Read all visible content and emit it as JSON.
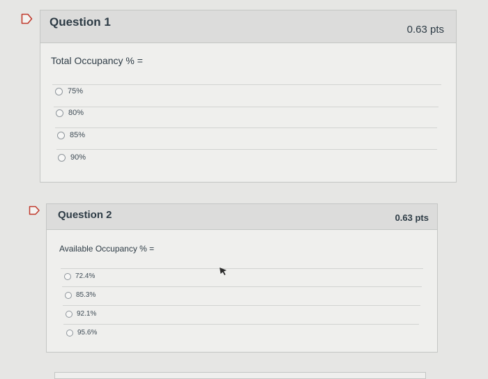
{
  "questions": [
    {
      "title": "Question 1",
      "points": "0.63 pts",
      "text": "Total Occupancy % =",
      "answers": [
        "75%",
        "80%",
        "85%",
        "90%"
      ]
    },
    {
      "title": "Question 2",
      "points": "0.63 pts",
      "text": "Available Occupancy % =",
      "answers": [
        "72.4%",
        "85.3%",
        "92.1%",
        "95.6%"
      ]
    }
  ],
  "colors": {
    "flag_outline": "#c0392b",
    "background": "#e6e6e4",
    "header": "#dcdcdb"
  },
  "icons": {
    "flag": "flag-question-icon",
    "cursor": "mouse-pointer-icon"
  }
}
